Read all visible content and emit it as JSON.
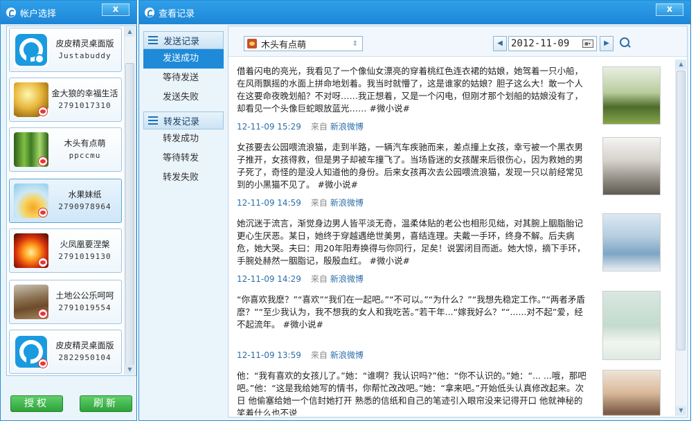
{
  "account_window": {
    "title": "帐户选择",
    "close": "x",
    "accounts": [
      {
        "name": "皮皮精灵桌面版",
        "id": "Justabuddy",
        "avatar": "pipi-logo"
      },
      {
        "name": "金大狼的幸福生活",
        "id": "2791017310",
        "avatar": "gold-ball"
      },
      {
        "name": "木头有点萌",
        "id": "ppccmu",
        "avatar": "green-bamboo"
      },
      {
        "name": "水果妹纸",
        "id": "2790978964",
        "avatar": "juice-splash"
      },
      {
        "name": "火凤凰要涅槃",
        "id": "2791019130",
        "avatar": "fire-phoenix"
      },
      {
        "name": "土地公公乐呵呵",
        "id": "2791019554",
        "avatar": "earth-landscape"
      },
      {
        "name": "皮皮精灵桌面版",
        "id": "2822950104",
        "avatar": "pipi-logo"
      }
    ],
    "authorize": "授权",
    "refresh": "刷新"
  },
  "view_window": {
    "title": "查看记录",
    "close": "x",
    "nav": [
      {
        "head": "发送记录",
        "items": [
          "发送成功",
          "等待发送",
          "发送失败"
        ]
      },
      {
        "head": "转发记录",
        "items": [
          "转发成功",
          "等待转发",
          "转发失败"
        ]
      }
    ],
    "active_item": "发送成功",
    "toolbar": {
      "account": "木头有点萌",
      "date": "2012-11-09",
      "calendar": "▦▾"
    },
    "posts": [
      {
        "text": "借着闪电的亮光，我看见了一个像仙女漂亮的穿着桃红色连衣裙的姑娘，她驾着一只小船，在风雨飘摇的水面上拼命地划着。我当时就懵了，这是谁家的姑娘？胆子这么大！敢一个人在这要命夜晚划船？不对呀……我正想着，又是一个闪电，但刚才那个划船的姑娘没有了，却看见一个头像巨蛇眼放蓝光……  #微小说#",
        "time": "12-11-09 15:29",
        "from": "来自",
        "source": "新浪微博"
      },
      {
        "text": "女孩要去公园喂流浪猫，走到半路，一辆汽车疾驰而来，差点撞上女孩，幸亏被一个黑衣男子推开，女孩得救，但是男子却被车撞飞了。当场昏迷的女孩醒来后很伤心，因为救她的男子死了，奇怪的是没人知道他的身份。后来女孩再次去公园喂流浪猫，发现一只以前经常见到的小黑猫不见了。  #微小说#",
        "time": "12-11-09 14:59",
        "from": "来自",
        "source": "新浪微博"
      },
      {
        "text": "她沉迷于流言，渐觉身边男人皆平淡无奇，温柔体贴的老公也相形见绌，对其腕上胭脂胎记更心生厌恶。某日，她终于穿越遇绝世美男，喜结连理。夫戴一手环，终身不解。后夫病危，她大哭。夫曰：用20年阳寿换得与你同行，足矣！说罢闭目而逝。她大惊，摘下手环，手腕处赫然一胭脂记，殷殷血红。  #微小说#",
        "time": "12-11-09 14:29",
        "from": "来自",
        "source": "新浪微博"
      },
      {
        "text": "“你喜欢我麽？”“喜欢”“我们在一起吧。”“不可以。”“为什么？”“我想先稳定工作。”“两者矛盾麽？”“至少我认为，我不想我的女人和我吃苦。”若干年...“嫁我好么？”“......对不起”爱，经不起流年。 #微小说#",
        "time": "12-11-09 13:59",
        "from": "来自",
        "source": "新浪微博"
      },
      {
        "text": "他：“我有喜欢的女孩儿了。”她：“谁啊？我认识吗?”他：“你不认识的。”她：“...  ...哦，那吧吧。”他：“这是我给她写的情书，你帮忙改改吧。”她：“拿来吧。”开始低头认真修改起来。次日  他偷塞给她一个信封她打开  熟悉的信纸和自己的笔迹引入眼帘没来记得开口  他就神秘的笑着什么也不说",
        "time": "",
        "from": "",
        "source": ""
      }
    ]
  }
}
